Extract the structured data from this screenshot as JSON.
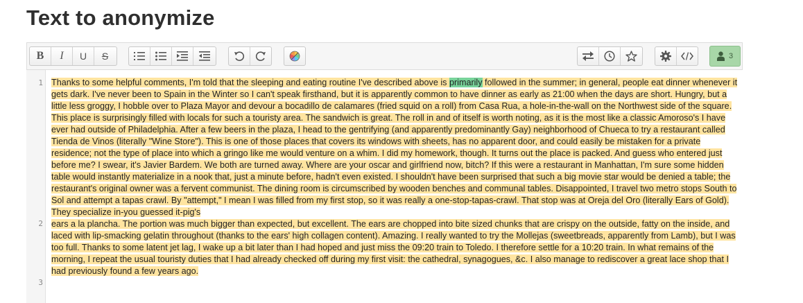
{
  "page": {
    "title": "Text to anonymize"
  },
  "toolbar": {
    "format_group": [
      {
        "name": "bold-button",
        "label": "B"
      },
      {
        "name": "italic-button",
        "label": "I"
      },
      {
        "name": "underline-button",
        "label": "U"
      },
      {
        "name": "strikethrough-button",
        "label": "S"
      }
    ],
    "users_count": "3"
  },
  "editor": {
    "line_numbers": [
      "1",
      "2",
      "3"
    ],
    "line1_before": "Thanks to some helpful comments, I'm told that the sleeping and eating routine I've described above is ",
    "line1_selected": "primarily",
    "line1_after": " followed in the summer; in general, people eat dinner whenever it gets dark. I've never been to Spain in the Winter so I can't speak firsthand, but it is apparently common to have dinner as early as 21:00 when the days are short. Hungry, but a little less groggy, I hobble over to Plaza Mayor and devour a bocadillo de calamares (fried squid on a roll) from Casa Rua, a hole-in-the-wall on the Northwest side of the square. This place is surprisingly filled with locals for such a touristy area. The sandwich is great. The roll in and of itself is worth noting, as it is the most like a classic Amoroso's I have ever had outside of Philadelphia.  After a few beers in the plaza, I head to the gentrifying (and apparently predominantly Gay) neighborhood of Chueca to try a restaurant called Tienda de Vinos (literally \"Wine Store\"). This is one of those places that covers its windows with sheets, has no apparent door, and could easily be mistaken for a private residence; not the type of place into which a gringo like me would venture on a whim. I did my homework, though. It turns out the place is packed. And guess who entered just before me? I swear, it's Javier Bardem. We both are turned away. Where are your oscar and girlfriend now, bitch? If this were a restaurant in Manhattan, I'm sure some hidden table would instantly materialize in a nook that, just a minute before, hadn't even existed. I shouldn't have been surprised that such a big movie star would be denied a table; the restaurant's original owner was a fervent communist. The dining room is circumscribed by wooden benches and communal tables.   Disappointed, I travel two metro stops South to Sol and attempt a tapas crawl. By \"attempt,\" I mean I was filled from my first stop, so it was really a one-stop-tapas-crawl. That stop was at Oreja del Oro (literally Ears of Gold). They specialize in-you guessed it-pig's",
    "line2": "ears a la plancha. The portion was much bigger than expected, but excellent. The ears are chopped into bite sized chunks that are crispy on the outside, fatty on the inside, and laced with lip-smacking gelatin throughout (thanks to the ears' high collagen content). Amazing. I really wanted to try the Mollejas (sweetbreads, apparently from Lamb), but I was too full.   Thanks to some latent jet lag, I wake up a bit later than I had hoped and just miss the 09:20 train to Toledo. I therefore settle for a 10:20 train.  In what remains of the morning, I repeat the usual touristy duties that I had already checked off during my first visit: the cathedral, synagogues, &c. I also manage to rediscover a great lace shop that I had previously found a few years ago."
  }
}
